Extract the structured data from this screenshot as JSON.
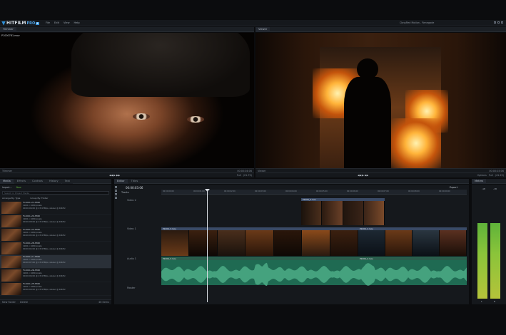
{
  "app": {
    "logo": "HITFILM",
    "logo_suffix": "PRO",
    "version_badge": "6",
    "window_title": "ClassRed Motion - Renegade"
  },
  "menu": [
    "File",
    "Edit",
    "View",
    "Help"
  ],
  "trimmer": {
    "tab": "Trimmer",
    "clip_name": "P1000781.mov",
    "zoom": "Full",
    "fit": "(21.75)",
    "timecode": "00:00:04:06"
  },
  "viewer": {
    "tab": "Viewer",
    "zoom": "Full",
    "fit": "(41.29)",
    "options": "Options"
  },
  "media_tabs": [
    "Media",
    "Effects",
    "Controls",
    "History",
    "Text"
  ],
  "media": {
    "import_label": "Import...",
    "new_label": "New",
    "search_placeholder": "Search in Project Media",
    "arrange_label": "Arrange By: Type",
    "group_label": "Group By: Folder",
    "items": [
      {
        "name": "P1000723.mov",
        "line1": "1920 x 1080 pixels",
        "line2": "00:00:06:00 @ 23.976fps, stereo @ 48kHz"
      },
      {
        "name": "P1000724.mov",
        "line1": "1920 x 1080 pixels",
        "line2": "00:00:08:00 @ 23.976fps, stereo @ 48kHz"
      },
      {
        "name": "P1000725.mov",
        "line1": "1920 x 1080 pixels",
        "line2": "00:00:05:00 @ 23.976fps, stereo @ 48kHz"
      },
      {
        "name": "P1000726.mov",
        "line1": "1920 x 1080 pixels",
        "line2": "00:00:04:00 @ 23.976fps, stereo @ 48kHz"
      },
      {
        "name": "P1000727.mov",
        "line1": "1920 x 1080 pixels",
        "line2": "00:00:07:00 @ 23.976fps, stereo @ 48kHz"
      },
      {
        "name": "P1000728.mov",
        "line1": "1920 x 1080 pixels",
        "line2": "00:00:06:00 @ 23.976fps, stereo @ 48kHz"
      },
      {
        "name": "P1000729.mov",
        "line1": "1920 x 1080 pixels",
        "line2": "00:00:09:00 @ 23.976fps, stereo @ 48kHz"
      }
    ],
    "new_folder": "New Folder",
    "delete": "Delete",
    "count": "46 Items"
  },
  "editor": {
    "tabs": [
      "Editor",
      "Titles"
    ],
    "timecode": "00:00:03:06",
    "tracks_label": "Tracks",
    "export_label": "Export",
    "tracks": [
      "Video 2",
      "Video 1",
      "Audio 1",
      "Master"
    ],
    "clips": {
      "video2": "P1000_3.mov",
      "video1_a": "P1000_3.mov",
      "video1_b": "P1000_2.mov",
      "audio_a": "P1000_3.mov",
      "audio_b": "P1000_2.mov"
    },
    "ruler": [
      "00:00:00:00",
      "00:00:01:00",
      "00:00:02:00",
      "00:00:03:00",
      "00:00:04:00",
      "00:00:05:00",
      "00:00:06:00",
      "00:00:07:00",
      "00:00:08:00",
      "00:00:09:00"
    ]
  },
  "meters": {
    "tab": "Meters",
    "left": "-18",
    "right": "-18",
    "l": "L",
    "r": "R"
  }
}
